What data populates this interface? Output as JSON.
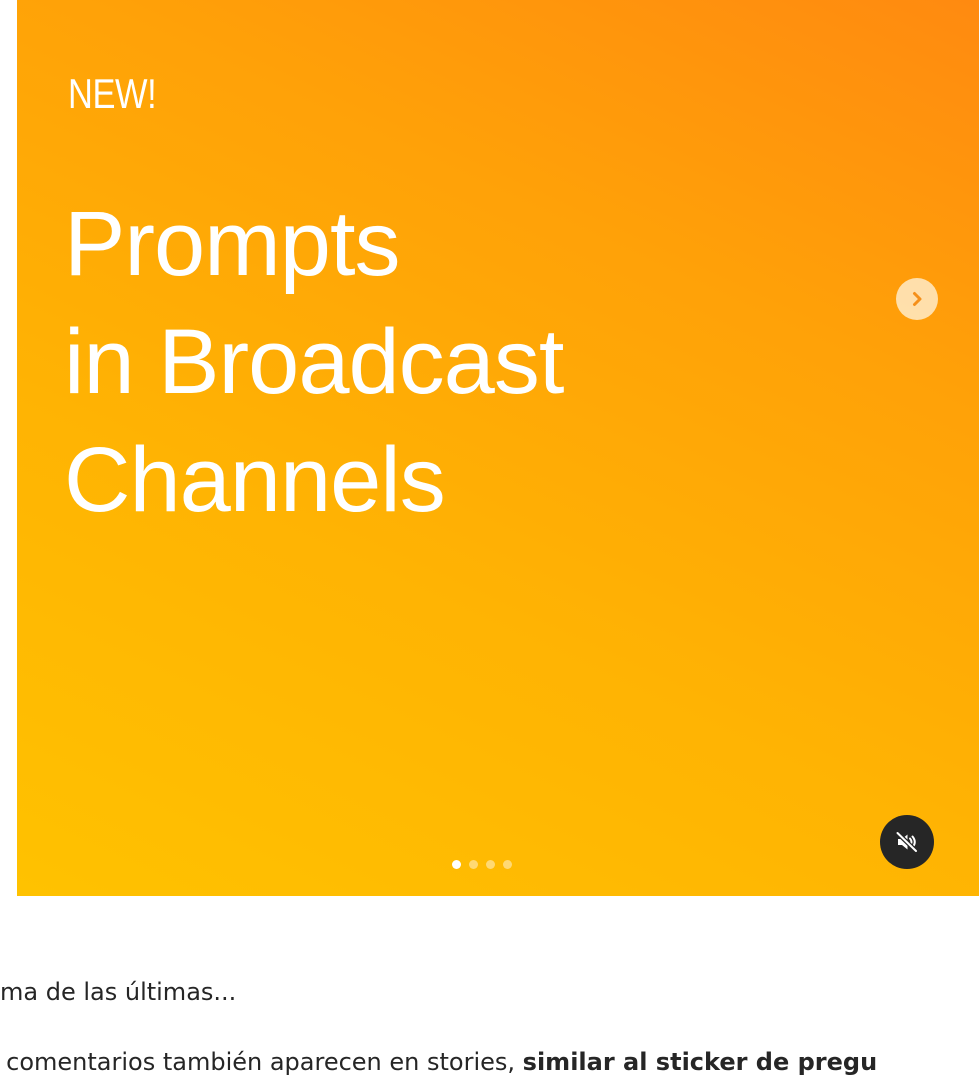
{
  "post": {
    "eyebrow": "NEW!",
    "headline": [
      "Prompts",
      "in Broadcast",
      "Channels"
    ],
    "carousel": {
      "slides": 4,
      "active_index": 0
    },
    "controls": {
      "next_icon": "chevron-right-icon",
      "mute_icon": "speaker-muted-icon"
    },
    "gradient_colors": [
      "#ff8a10",
      "#ffc200"
    ]
  },
  "caption": {
    "line1": "ma de las últimas...",
    "line2_regular": "s comentarios también aparecen en stories, ",
    "line2_bold": "similar al sticker de pregu"
  }
}
